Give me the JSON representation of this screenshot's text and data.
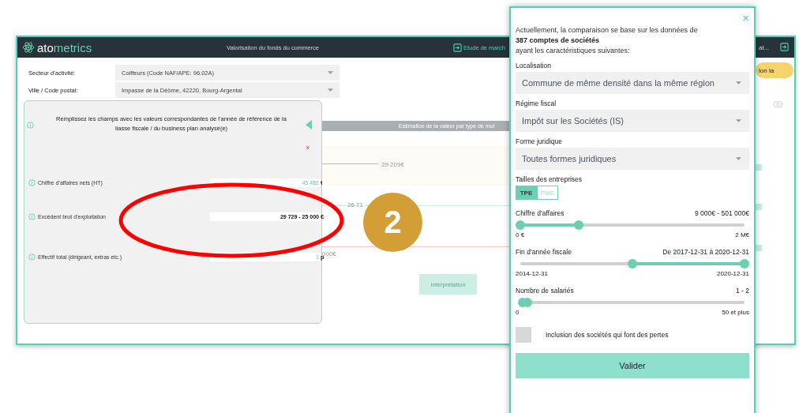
{
  "app": {
    "logo_prefix": "ato",
    "logo_suffix": "metrics",
    "title": "Valorisation du fonds du commerce",
    "header_link": "Etude de march",
    "header_link_right": "at...",
    "pill_button": "lon la"
  },
  "filters": [
    {
      "label": "Secteur d’activité:",
      "value": "Coiffeurs (Code NAF/APE: 96.02A)"
    },
    {
      "label": "Ville / Code postal:",
      "value": "Impasse de la Déôme, 42220, Bourg-Argental"
    }
  ],
  "form_panel": {
    "title": "Remplissez les champs avec les valeurs correspondantes de l’année de référence de la liasse fiscale / du business plan analysé(e)",
    "close": "×",
    "fields": [
      {
        "label": "Chiffre d’affaires nets (HT)",
        "value": "45 482",
        "unit": "€",
        "kind": "plain"
      },
      {
        "label": "Excédent brut d’exploitation",
        "value": "29 729 - 25 000",
        "unit": "€",
        "kind": "edited"
      },
      {
        "label": "Effectif total (dirigeant, extras etc.)",
        "value": "1",
        "unit": "p",
        "kind": "plain"
      }
    ]
  },
  "results": {
    "header": "Estimation de la valeur par type de mul",
    "label_1": "29 209€",
    "label_2": "26 71",
    "label_3": "000€",
    "button": "Interprétation"
  },
  "filter_panel": {
    "close": "×",
    "intro": "Actuellement, la comparaison se base sur les données de",
    "count": "387 comptes de sociétés",
    "outro": "ayant les caractéristiques suivantes:",
    "selects": [
      {
        "label": "Localisation",
        "value": "Commune de même densité dans la même région"
      },
      {
        "label": "Régime fiscal",
        "value": "Impôt sur les Sociétés (IS)"
      },
      {
        "label": "Forme juridique",
        "value": "Toutes formes juridiques"
      }
    ],
    "sizes_label": "Tailles des entreprises",
    "sizes": [
      {
        "label": "TPE",
        "selected": true
      },
      {
        "label": "PME",
        "selected": false
      }
    ],
    "sliders": [
      {
        "label": "Chiffre d’affaires",
        "reading": "9 000€ - 501 000€",
        "min": "0 €",
        "max": "2 M€",
        "thumbs": [
          {
            "level": 0
          },
          {
            "level": 0.26
          }
        ]
      },
      {
        "label": "Fin d’année fiscale",
        "reading": "De 2017-12-31 à 2020-12-31",
        "min": "2014-12-31",
        "max": "2020-12-31",
        "thumbs": [
          {
            "level": 0.5
          },
          {
            "level": 1
          }
        ]
      },
      {
        "label": "Nombre de salariés",
        "reading": "1 - 2",
        "min": "0",
        "max": "50 et plus",
        "thumbs": [
          {
            "level": 0.01
          },
          {
            "level": 0.03
          }
        ]
      }
    ],
    "checkbox": {
      "label": "Inclusion des sociétés qui font des pertes",
      "checked": false
    },
    "submit": "Valider"
  },
  "step_badge": {
    "label": "2"
  }
}
